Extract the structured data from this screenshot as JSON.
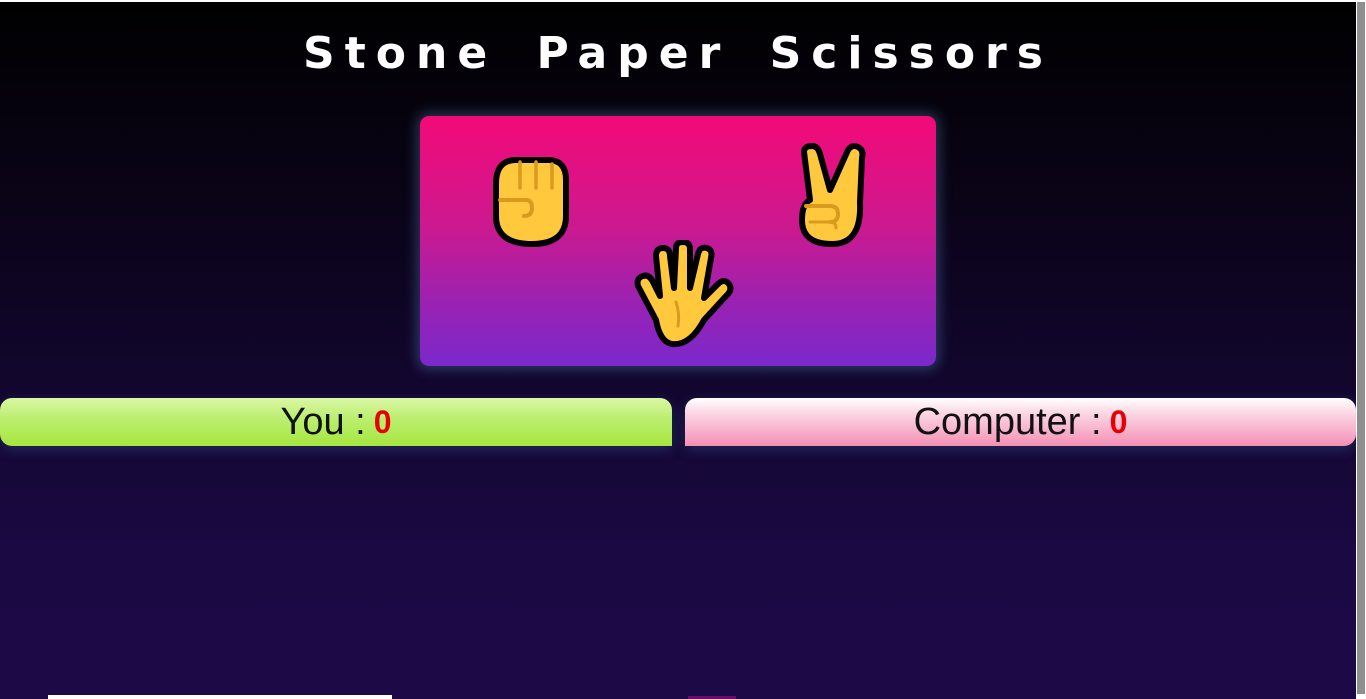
{
  "game": {
    "title": "Stone Paper Scissors"
  },
  "choices": [
    {
      "id": "stone",
      "icon": "raised-fist-icon"
    },
    {
      "id": "paper",
      "icon": "raised-hand-icon"
    },
    {
      "id": "scissors",
      "icon": "victory-hand-icon"
    }
  ],
  "scoreboard": {
    "user_label": "You :",
    "user_score": "0",
    "computer_label": "Computer :",
    "computer_score": "0"
  },
  "colors": {
    "board_top": "#f30a77",
    "board_bottom": "#7b28cc",
    "user_box": "#bdef72",
    "computer_box": "#f48fb5",
    "score_number": "#e60000",
    "hand_fill": "#ffc83d",
    "hand_outline": "#000000"
  }
}
